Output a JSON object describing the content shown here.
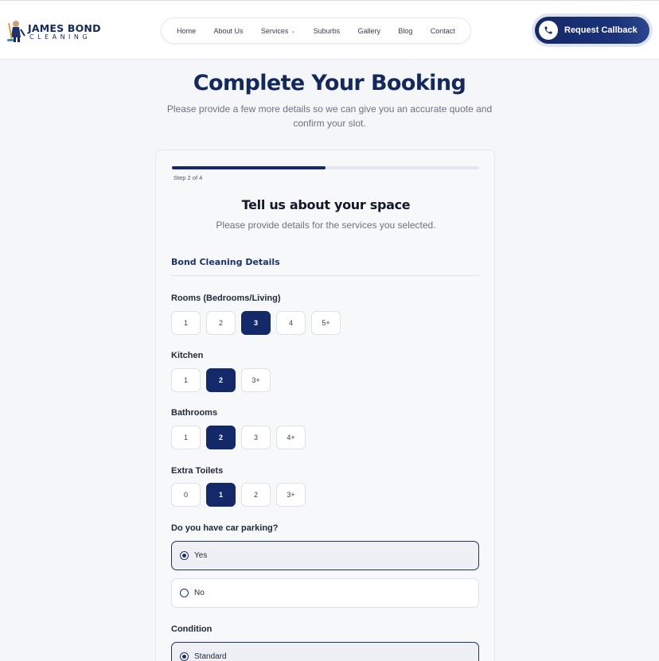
{
  "brand": {
    "name": "JAMES BOND",
    "tagline": "CLEANING"
  },
  "nav": {
    "items": [
      {
        "label": "Home"
      },
      {
        "label": "About Us"
      },
      {
        "label": "Services"
      },
      {
        "label": "Suburbs"
      },
      {
        "label": "Gallery"
      },
      {
        "label": "Blog"
      },
      {
        "label": "Contact"
      }
    ]
  },
  "callback": {
    "label": "Request Callback"
  },
  "page": {
    "title": "Complete Your Booking",
    "subtitle": "Please provide a few more details so we can give you an accurate quote and confirm your slot."
  },
  "form": {
    "progress_fraction": 0.5,
    "step_label": "Step 2 of 4",
    "title": "Tell us about your space",
    "subtitle": "Please provide details for the services you selected.",
    "section_title": "Bond Cleaning Details",
    "rooms": {
      "label": "Rooms (Bedrooms/Living)",
      "options": [
        "1",
        "2",
        "3",
        "4",
        "5+"
      ],
      "selected": "3"
    },
    "kitchen": {
      "label": "Kitchen",
      "options": [
        "1",
        "2",
        "3+"
      ],
      "selected": "2"
    },
    "bathrooms": {
      "label": "Bathrooms",
      "options": [
        "1",
        "2",
        "3",
        "4+"
      ],
      "selected": "2"
    },
    "toilets": {
      "label": "Extra Toilets",
      "options": [
        "0",
        "1",
        "2",
        "3+"
      ],
      "selected": "1"
    },
    "parking": {
      "label": "Do you have car parking?",
      "options": [
        "Yes",
        "No"
      ],
      "selected": "Yes"
    },
    "condition": {
      "label": "Condition",
      "options": [
        "Standard"
      ],
      "selected": "Standard"
    }
  },
  "colors": {
    "primary": "#14296a",
    "accent_text": "#1c3170",
    "background": "#f5f6f8"
  }
}
